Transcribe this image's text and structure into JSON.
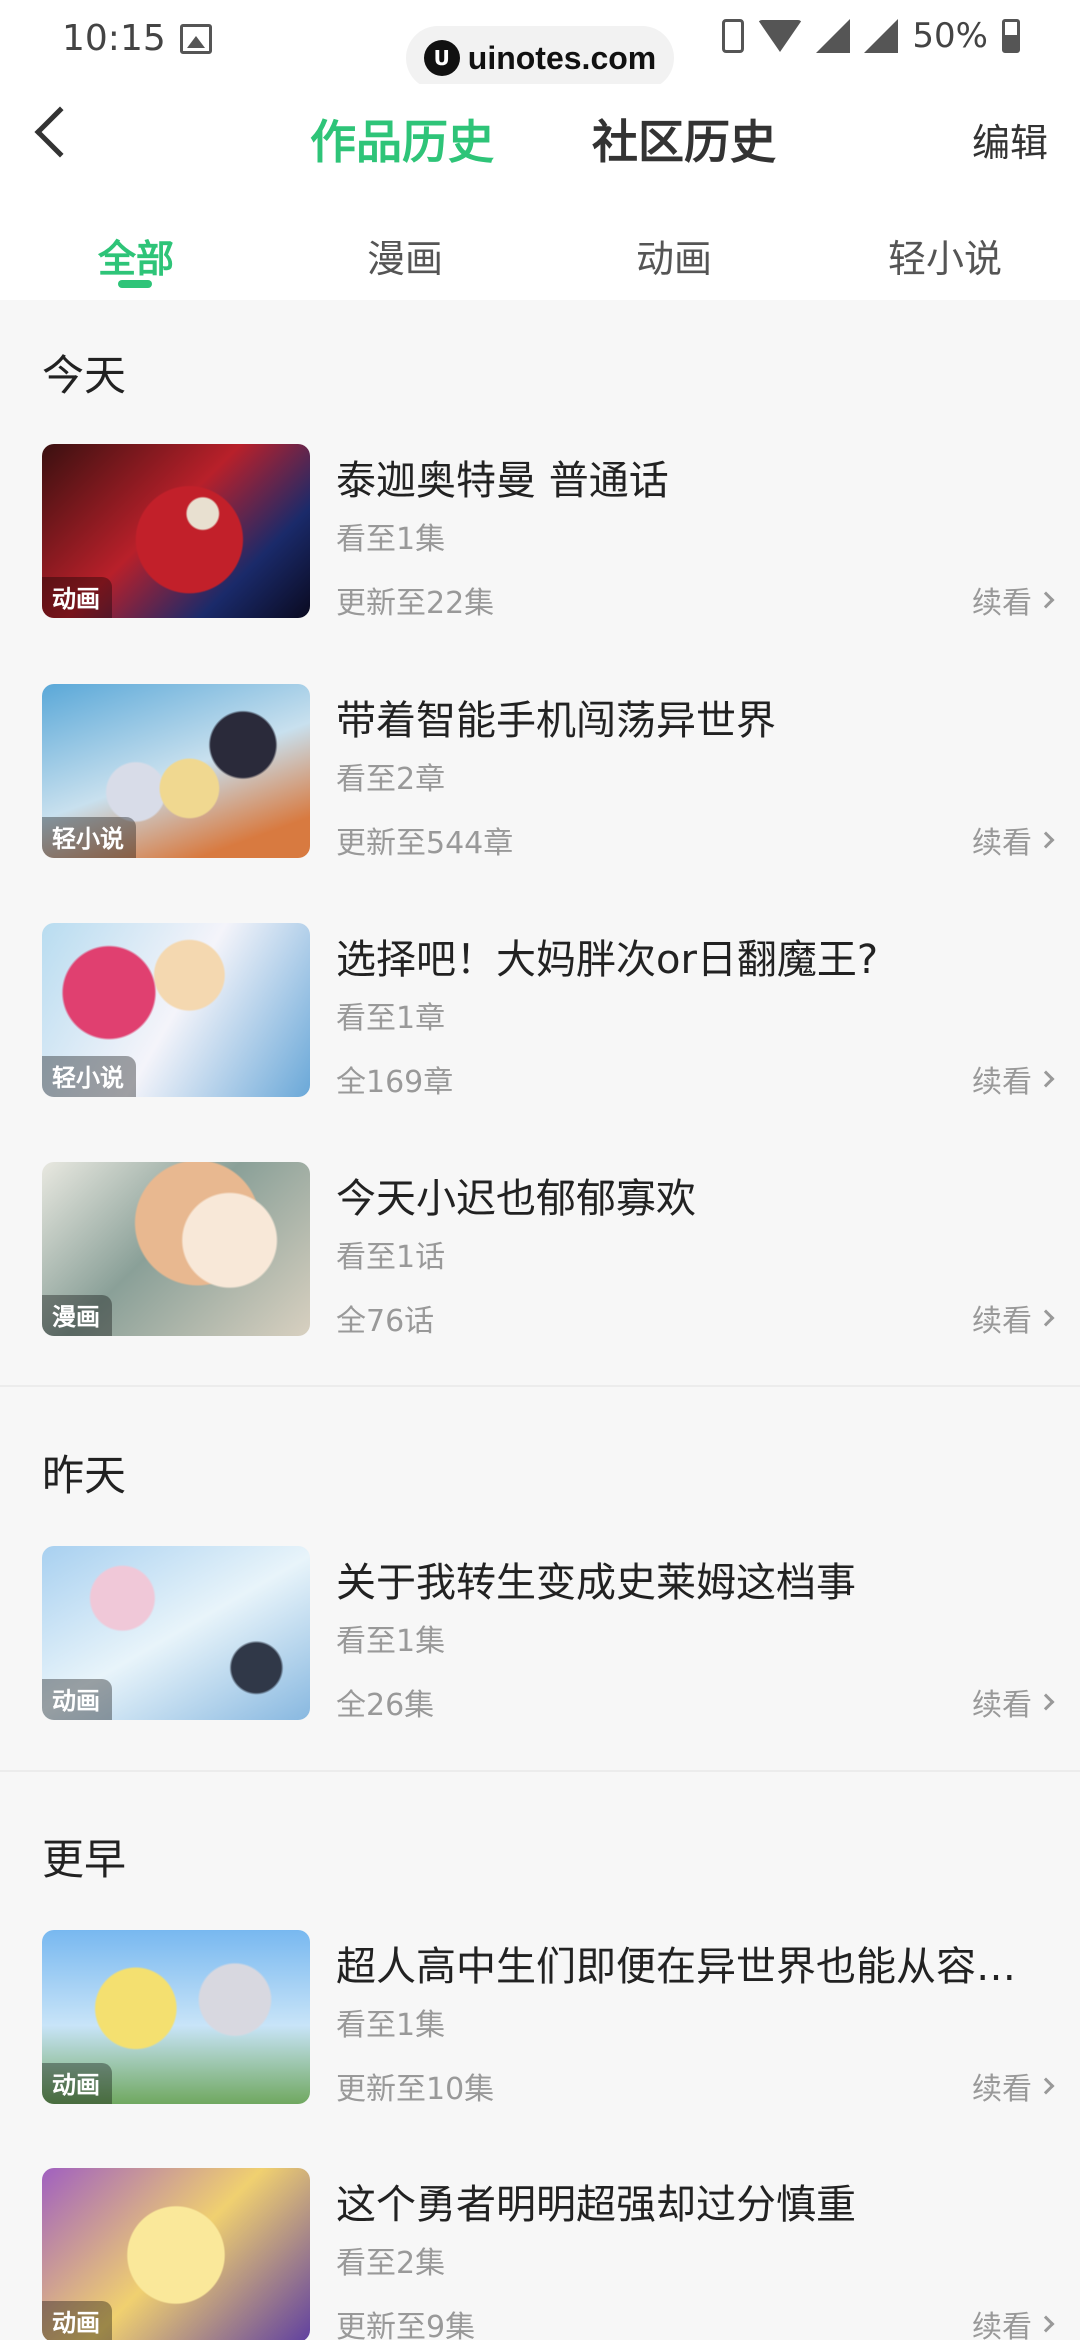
{
  "status": {
    "time": "10:15",
    "watermark": "uinotes.com",
    "watermark_logo": "U",
    "battery": "50%"
  },
  "header": {
    "tab_works": "作品历史",
    "tab_community": "社区历史",
    "edit": "编辑"
  },
  "subtabs": [
    "全部",
    "漫画",
    "动画",
    "轻小说"
  ],
  "sections": [
    {
      "title": "今天",
      "items": [
        {
          "title": "泰迦奥特曼 普通话",
          "progress": "看至1集",
          "update": "更新至22集",
          "tag": "动画",
          "continue": "续看"
        },
        {
          "title": "带着智能手机闯荡异世界",
          "progress": "看至2章",
          "update": "更新至544章",
          "tag": "轻小说",
          "continue": "续看"
        },
        {
          "title": "选择吧！大妈胖次or日翻魔王?",
          "progress": "看至1章",
          "update": "全169章",
          "tag": "轻小说",
          "continue": "续看"
        },
        {
          "title": "今天小迟也郁郁寡欢",
          "progress": "看至1话",
          "update": "全76话",
          "tag": "漫画",
          "continue": "续看"
        }
      ]
    },
    {
      "title": "昨天",
      "items": [
        {
          "title": "关于我转生变成史莱姆这档事",
          "progress": "看至1集",
          "update": "全26集",
          "tag": "动画",
          "continue": "续看"
        }
      ]
    },
    {
      "title": "更早",
      "items": [
        {
          "title": "超人高中生们即便在异世界也能从容…",
          "progress": "看至1集",
          "update": "更新至10集",
          "tag": "动画",
          "continue": "续看"
        },
        {
          "title": "这个勇者明明超强却过分慎重",
          "progress": "看至2集",
          "update": "更新至9集",
          "tag": "动画",
          "continue": "续看"
        }
      ]
    }
  ],
  "colors": {
    "accent": "#2ec478"
  }
}
